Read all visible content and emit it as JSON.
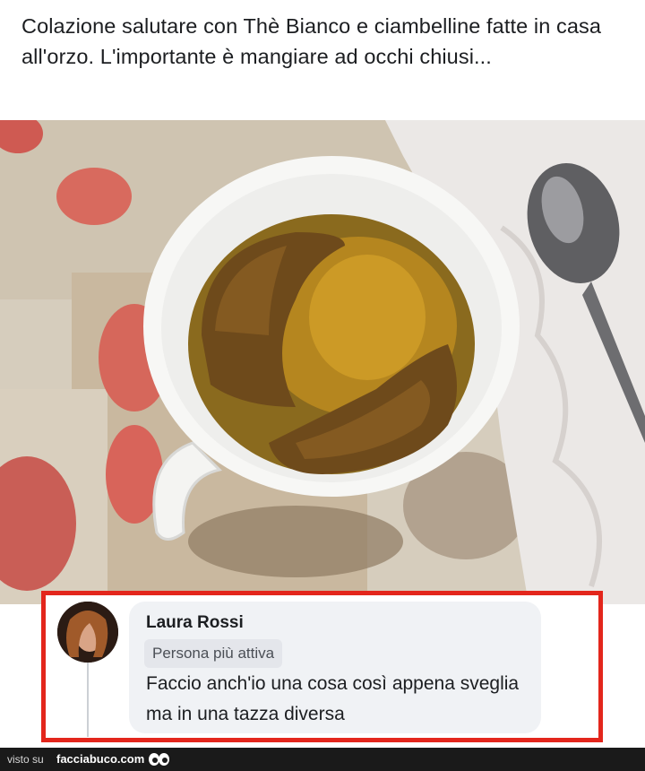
{
  "post": {
    "text": "Colazione salutare con Thè Bianco e ciambelline fatte in casa all'orzo. L'importante è mangiare ad occhi chiusi..."
  },
  "comment": {
    "author": "Laura Rossi",
    "badge": "Persona più attiva",
    "text": "Faccio anch'io una cosa così appena sveglia ma in una tazza diversa"
  },
  "footer": {
    "visto_su": "visto su",
    "site": "facciabuco.com"
  },
  "colors": {
    "highlight_border": "#e3261c",
    "bubble_bg": "#f0f2f5",
    "footer_bg": "#1a1a1a"
  },
  "icons": {
    "footer_logo": "eyes-icon"
  }
}
